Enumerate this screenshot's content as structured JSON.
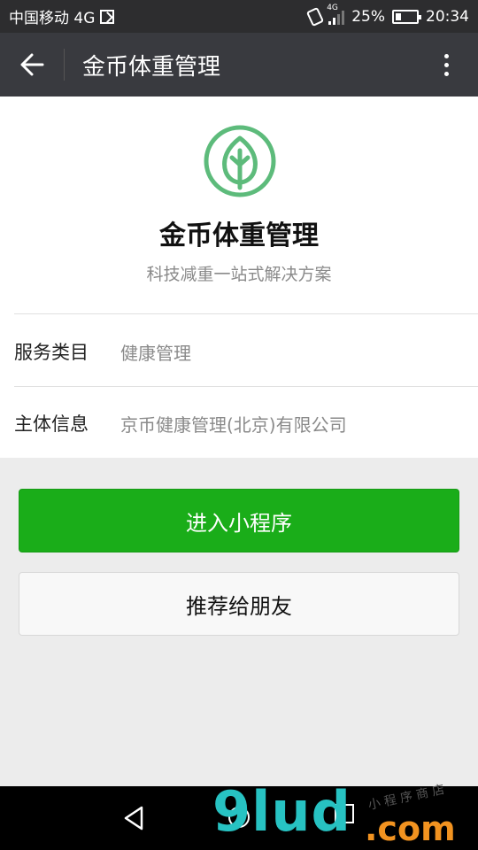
{
  "status_bar": {
    "carrier": "中国移动 4G",
    "network_badge": "4G",
    "battery_percent": "25%",
    "time": "20:34",
    "icons": [
      "image-icon",
      "vibrate-icon",
      "signal-icon",
      "battery-icon"
    ]
  },
  "header": {
    "title": "金币体重管理",
    "icons": [
      "back-arrow-icon",
      "more-vertical-icon"
    ]
  },
  "app": {
    "logo_icon": "leaf-icon",
    "name": "金币体重管理",
    "slogan": "科技减重一站式解决方案",
    "brand_color": "#5dbb7b"
  },
  "info_rows": [
    {
      "label": "服务类目",
      "value": "健康管理"
    },
    {
      "label": "主体信息",
      "value": "京币健康管理(北京)有限公司"
    }
  ],
  "actions": {
    "enter_label": "进入小程序",
    "share_label": "推荐给朋友",
    "enter_color": "#1aad19"
  },
  "nav_bar": {
    "icons": [
      "nav-back-icon",
      "nav-home-icon",
      "nav-recent-icon"
    ]
  },
  "watermark": {
    "main": "9lud",
    "domain": ".com",
    "small": "小 程 序 商 店"
  }
}
